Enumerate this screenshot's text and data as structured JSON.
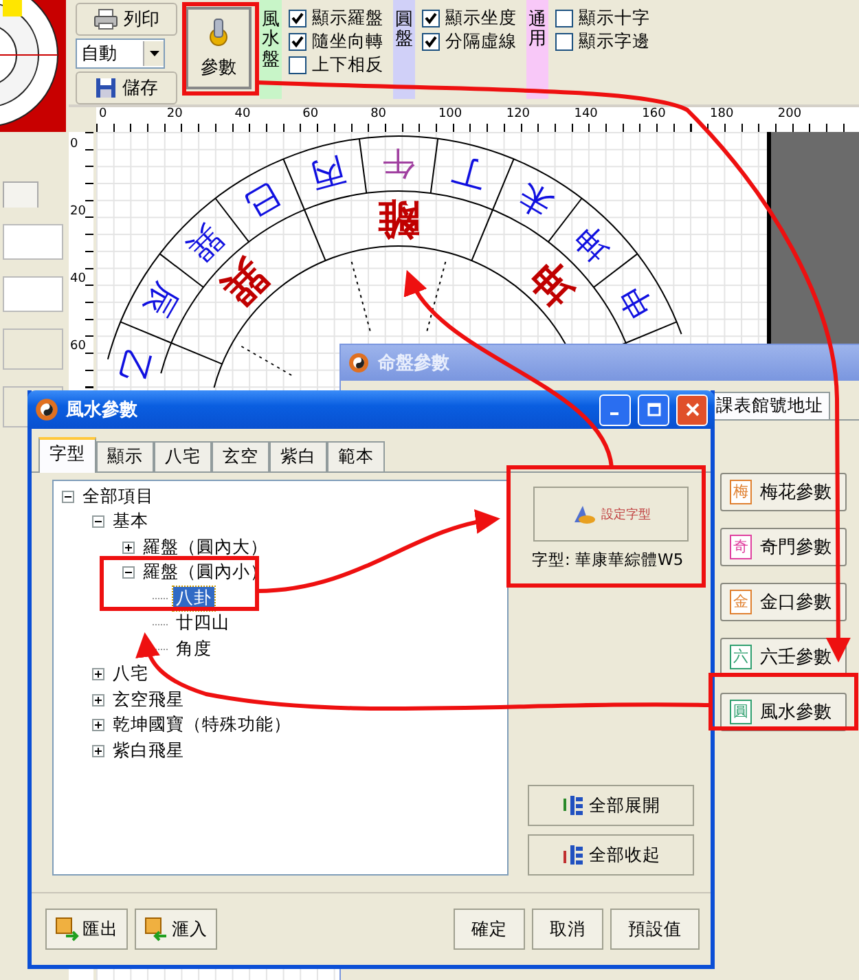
{
  "toolbar": {
    "print_button": "列印",
    "mode_select": {
      "value": "自動"
    },
    "save_button": "儲存",
    "params_button": "參數",
    "groups": [
      {
        "label": "風水盤",
        "color": "#c8f5c8",
        "options": [
          {
            "label": "顯示羅盤",
            "checked": true
          },
          {
            "label": "隨坐向轉",
            "checked": true
          },
          {
            "label": "上下相反",
            "checked": false
          }
        ]
      },
      {
        "label": "圓盤",
        "color": "#d0d0f8",
        "options": [
          {
            "label": "顯示坐度",
            "checked": true
          },
          {
            "label": "分隔虛線",
            "checked": true
          }
        ]
      },
      {
        "label": "通用",
        "color": "#f8c8f8",
        "options": [
          {
            "label": "顯示十字",
            "checked": false
          },
          {
            "label": "顯示字邊",
            "checked": false
          }
        ]
      }
    ]
  },
  "ruler": {
    "top_ticks": [
      "0",
      "20",
      "40",
      "60",
      "80",
      "100",
      "120",
      "140",
      "160",
      "180",
      "200"
    ],
    "side_ticks": [
      "0",
      "20",
      "40",
      "60"
    ]
  },
  "compass": {
    "outer_ring": [
      {
        "label": "乙",
        "color": "#1010e0"
      },
      {
        "label": "辰",
        "color": "#1010e0"
      },
      {
        "label": "巽",
        "color": "#1010e0"
      },
      {
        "label": "巳",
        "color": "#1010e0"
      },
      {
        "label": "丙",
        "color": "#1010e0"
      },
      {
        "label": "午",
        "color": "#a040a0"
      },
      {
        "label": "丁",
        "color": "#1010e0"
      },
      {
        "label": "未",
        "color": "#1010e0"
      },
      {
        "label": "坤",
        "color": "#1010e0"
      },
      {
        "label": "申",
        "color": "#1010e0"
      }
    ],
    "inner_ring": [
      {
        "label": "巽",
        "color": "#c00000"
      },
      {
        "label": "離",
        "color": "#c00000"
      },
      {
        "label": "坤",
        "color": "#c00000"
      }
    ]
  },
  "back_window": {
    "title": "命盤參數",
    "tab": "課表館號地址",
    "buttons": [
      {
        "glyph": "梅",
        "label": "梅花參數",
        "color": "#e08030"
      },
      {
        "glyph": "奇",
        "label": "奇門參數",
        "color": "#e040a0"
      },
      {
        "glyph": "金",
        "label": "金口參數",
        "color": "#e08030"
      },
      {
        "glyph": "六",
        "label": "六壬參數",
        "color": "#30a070"
      },
      {
        "glyph": "圓",
        "label": "風水參數",
        "color": "#30a070"
      }
    ]
  },
  "dialog": {
    "title": "風水參數",
    "tabs": [
      {
        "label": "字型",
        "selected": true
      },
      {
        "label": "顯示",
        "selected": false
      },
      {
        "label": "八宅",
        "selected": false
      },
      {
        "label": "玄空",
        "selected": false
      },
      {
        "label": "紫白",
        "selected": false
      },
      {
        "label": "範本",
        "selected": false
      }
    ],
    "tree": [
      {
        "label": "全部項目",
        "expanded": true,
        "selected": false,
        "children": [
          {
            "label": "基本",
            "expanded": true,
            "selected": false,
            "children": [
              {
                "label": "羅盤（圓內大）",
                "expanded": false,
                "selected": false
              },
              {
                "label": "羅盤（圓內小）",
                "expanded": true,
                "selected": false,
                "children": [
                  {
                    "label": "八卦",
                    "selected": true
                  },
                  {
                    "label": "廿四山",
                    "selected": false
                  },
                  {
                    "label": "角度",
                    "selected": false
                  }
                ]
              }
            ]
          },
          {
            "label": "八宅",
            "expanded": false,
            "selected": false
          },
          {
            "label": "玄空飛星",
            "expanded": false,
            "selected": false
          },
          {
            "label": "乾坤國寶（特殊功能）",
            "expanded": false,
            "selected": false
          },
          {
            "label": "紫白飛星",
            "expanded": false,
            "selected": false
          }
        ]
      }
    ],
    "font_button": "設定字型",
    "font_label": "字型: 華康華綜體W5",
    "expand_all_button": "全部展開",
    "collapse_all_button": "全部收起",
    "export_button": "匯出",
    "import_button": "滙入",
    "footer_buttons": [
      "確定",
      "取消",
      "預設值"
    ]
  }
}
